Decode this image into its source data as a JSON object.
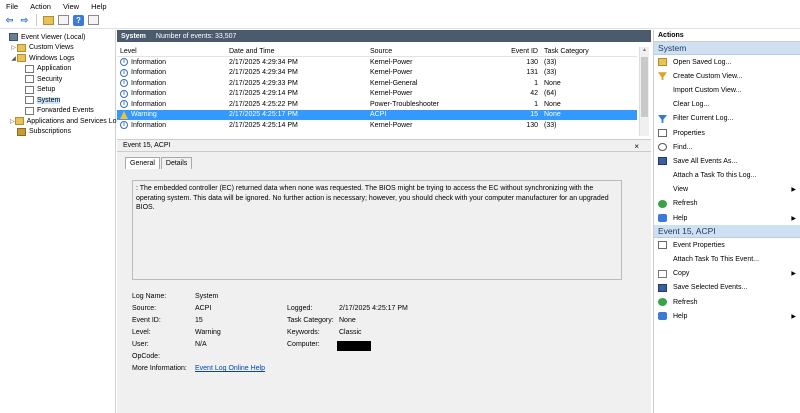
{
  "menu": [
    "File",
    "Action",
    "View",
    "Help"
  ],
  "tree": [
    {
      "label": "Event Viewer (Local)",
      "indent": 0,
      "exp": "",
      "icon": "event-viewer-icon",
      "cls": "ic-ev"
    },
    {
      "label": "Custom Views",
      "indent": 1,
      "exp": "▷",
      "icon": "folder-icon",
      "cls": "ic-folder"
    },
    {
      "label": "Windows Logs",
      "indent": 1,
      "exp": "◢",
      "icon": "folder-icon",
      "cls": "ic-folder"
    },
    {
      "label": "Application",
      "indent": 2,
      "exp": "",
      "icon": "log-icon",
      "cls": "ic-log"
    },
    {
      "label": "Security",
      "indent": 2,
      "exp": "",
      "icon": "log-icon",
      "cls": "ic-log"
    },
    {
      "label": "Setup",
      "indent": 2,
      "exp": "",
      "icon": "log-icon",
      "cls": "ic-log"
    },
    {
      "label": "System",
      "indent": 2,
      "exp": "",
      "icon": "log-icon",
      "cls": "ic-log",
      "selected": true
    },
    {
      "label": "Forwarded Events",
      "indent": 2,
      "exp": "",
      "icon": "log-icon",
      "cls": "ic-log"
    },
    {
      "label": "Applications and Services Lo",
      "indent": 1,
      "exp": "▷",
      "icon": "folder-icon",
      "cls": "ic-folder"
    },
    {
      "label": "Subscriptions",
      "indent": 1,
      "exp": "",
      "icon": "subscriptions-icon",
      "cls": "ic-filter"
    }
  ],
  "log_header": {
    "title": "System",
    "count_text": "Number of events: 33,507"
  },
  "columns": {
    "level": "Level",
    "date": "Date and Time",
    "source": "Source",
    "event_id": "Event ID",
    "task": "Task Category"
  },
  "events": [
    {
      "level": "Information",
      "date": "2/17/2025 4:29:34 PM",
      "source": "Kernel-Power",
      "event_id": "130",
      "task": "(33)",
      "type": "info"
    },
    {
      "level": "Information",
      "date": "2/17/2025 4:29:34 PM",
      "source": "Kernel-Power",
      "event_id": "131",
      "task": "(33)",
      "type": "info"
    },
    {
      "level": "Information",
      "date": "2/17/2025 4:29:33 PM",
      "source": "Kernel-General",
      "event_id": "1",
      "task": "None",
      "type": "info"
    },
    {
      "level": "Information",
      "date": "2/17/2025 4:29:14 PM",
      "source": "Kernel-Power",
      "event_id": "42",
      "task": "(64)",
      "type": "info"
    },
    {
      "level": "Information",
      "date": "2/17/2025 4:25:22 PM",
      "source": "Power-Troubleshooter",
      "event_id": "1",
      "task": "None",
      "type": "info"
    },
    {
      "level": "Warning",
      "date": "2/17/2025 4:25:17 PM",
      "source": "ACPI",
      "event_id": "15",
      "task": "None",
      "type": "warn",
      "selected": true
    },
    {
      "level": "Information",
      "date": "2/17/2025 4:25:14 PM",
      "source": "Kernel-Power",
      "event_id": "130",
      "task": "(33)",
      "type": "info"
    }
  ],
  "detail": {
    "title": "Event 15, ACPI",
    "close": "×",
    "tab_general": "General",
    "tab_details": "Details",
    "message": ": The embedded controller (EC) returned data when none was requested. The BIOS might be trying to access the EC without synchronizing with the operating system. This data will be ignored. No further action is necessary; however, you should check with your computer manufacturer for an upgraded BIOS.",
    "labels": {
      "log_name": "Log Name:",
      "source": "Source:",
      "event_id": "Event ID:",
      "level": "Level:",
      "user": "User:",
      "opcode": "OpCode:",
      "more_info": "More Information:",
      "logged": "Logged:",
      "task_category": "Task Category:",
      "keywords": "Keywords:",
      "computer": "Computer:"
    },
    "values": {
      "log_name": "System",
      "source": "ACPI",
      "event_id": "15",
      "level": "Warning",
      "user": "N/A",
      "opcode": "",
      "more_info": "Event Log Online Help",
      "logged": "2/17/2025 4:25:17 PM",
      "task_category": "None",
      "keywords": "Classic",
      "computer": ""
    }
  },
  "actions": {
    "title": "Actions",
    "section_system": "System",
    "system_items": [
      {
        "label": "Open Saved Log...",
        "icon": "open-log-icon",
        "cls": "ai-open"
      },
      {
        "label": "Create Custom View...",
        "icon": "create-view-icon",
        "cls": "ai-custom"
      },
      {
        "label": "Import Custom View...",
        "icon": "",
        "cls": "ai-blank"
      },
      {
        "label": "Clear Log...",
        "icon": "",
        "cls": "ai-blank"
      },
      {
        "label": "Filter Current Log...",
        "icon": "filter-icon",
        "cls": "ai-filter"
      },
      {
        "label": "Properties",
        "icon": "properties-icon",
        "cls": "ai-props"
      },
      {
        "label": "Find...",
        "icon": "find-icon",
        "cls": "ai-find"
      },
      {
        "label": "Save All Events As...",
        "icon": "save-icon",
        "cls": "ai-save"
      },
      {
        "label": "Attach a Task To this Log...",
        "icon": "",
        "cls": "ai-blank"
      },
      {
        "label": "View",
        "icon": "",
        "cls": "ai-blank",
        "submenu": true
      },
      {
        "label": "Refresh",
        "icon": "refresh-icon",
        "cls": "ai-refresh"
      },
      {
        "label": "Help",
        "icon": "help-icon",
        "cls": "ai-help",
        "submenu": true
      }
    ],
    "section_event": "Event 15, ACPI",
    "event_items": [
      {
        "label": "Event Properties",
        "icon": "properties-icon",
        "cls": "ai-props"
      },
      {
        "label": "Attach Task To This Event...",
        "icon": "",
        "cls": "ai-blank"
      },
      {
        "label": "Copy",
        "icon": "copy-icon",
        "cls": "ai-copy",
        "submenu": true
      },
      {
        "label": "Save Selected Events...",
        "icon": "save-icon",
        "cls": "ai-save"
      },
      {
        "label": "Refresh",
        "icon": "refresh-icon",
        "cls": "ai-refresh"
      },
      {
        "label": "Help",
        "icon": "help-icon",
        "cls": "ai-help",
        "submenu": true
      }
    ]
  },
  "colors": {
    "header_bar": "#4b5b6e",
    "selection": "#3399ff",
    "actions_section": "#cfe0f3"
  }
}
